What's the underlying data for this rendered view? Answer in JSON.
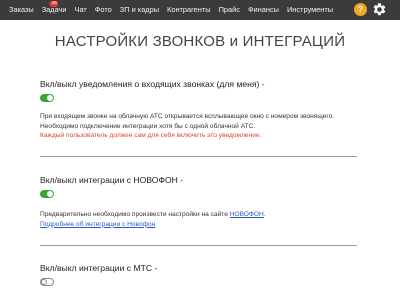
{
  "nav": {
    "items": [
      {
        "label": "Заказы"
      },
      {
        "label": "Задачи",
        "badge": "46"
      },
      {
        "label": "Чат"
      },
      {
        "label": "Фото"
      },
      {
        "label": "ЗП и кадры"
      },
      {
        "label": "Контрагенты"
      },
      {
        "label": "Прайс"
      },
      {
        "label": "Финансы"
      },
      {
        "label": "Инструменты"
      }
    ],
    "help_label": "?",
    "help_icon": "question-icon",
    "settings_icon": "gear-icon",
    "colors": {
      "bar": "#3b3b3b",
      "badge": "#e53935",
      "help": "#f5a623"
    }
  },
  "page": {
    "title": "НАСТРОЙКИ ЗВОНКОВ и ИНТЕГРАЦИЙ"
  },
  "sections": {
    "incoming": {
      "title": "Вкл/выкл уведомления о входящих звонках (для меня) -",
      "enabled": true,
      "desc_line1": "При входящем звонке на облачную АТС открывается всплывающее окно с номером звонящего.",
      "desc_line2": "Необходимо подключение интеграции хотя бы с одной облачной АТС.",
      "warning": "Каждый пользователь должен сам для себя включить это уведомление."
    },
    "novofon": {
      "title": "Вкл/выкл интеграции с НОВОФОН -",
      "enabled": true,
      "desc_prefix": "Предварительно необходимо произвести настройки на сайте ",
      "site_link": "НОВОФОН",
      "desc_suffix": ".",
      "more_link": "Подробнее об интеграции с Новофон"
    },
    "mts": {
      "title": "Вкл/выкл интеграции с МТС -",
      "enabled": false
    }
  },
  "colors": {
    "toggle_on": "#3aa53a",
    "warning": "#e0442c",
    "link": "#2a59c6"
  }
}
